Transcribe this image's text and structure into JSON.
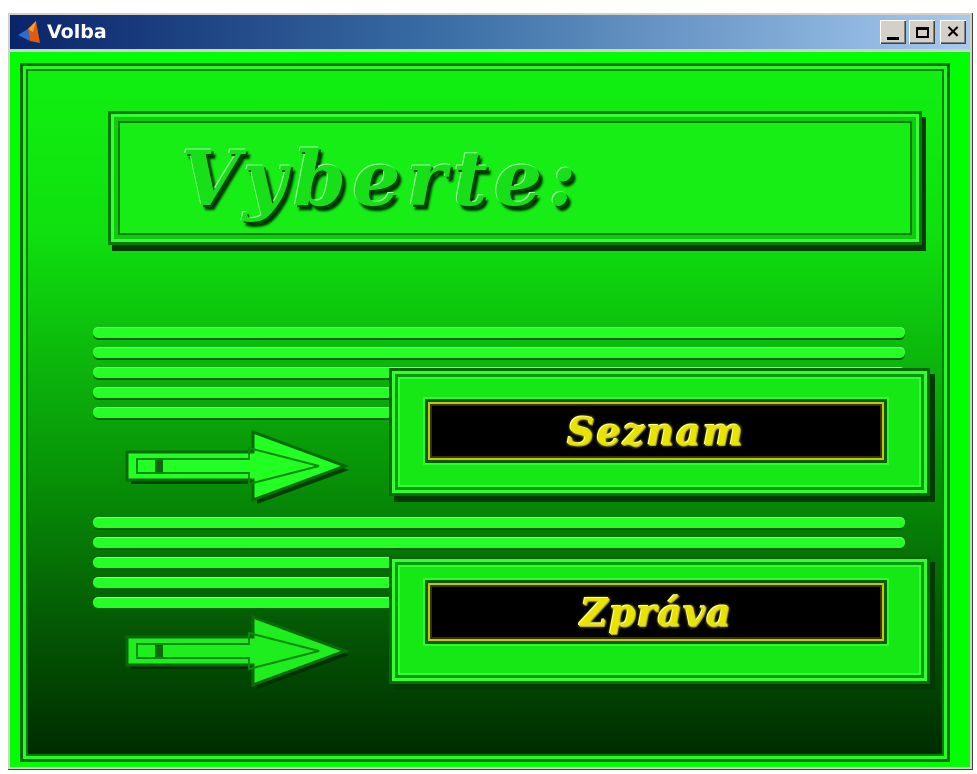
{
  "window": {
    "title": "Volba",
    "buttons": {
      "minimize": "minimize",
      "maximize": "maximize",
      "close": "×"
    }
  },
  "header": {
    "title": "Vyberte:"
  },
  "options": [
    {
      "label": "Seznam"
    },
    {
      "label": "Zpráva"
    }
  ],
  "colors": {
    "background_top": "#10f010",
    "background_bottom": "#002a00",
    "button_face": "#000000",
    "button_text": "#e8e400",
    "accent": "#26ff26"
  },
  "icons": [
    "matlab-icon",
    "arrow-right-icon"
  ]
}
